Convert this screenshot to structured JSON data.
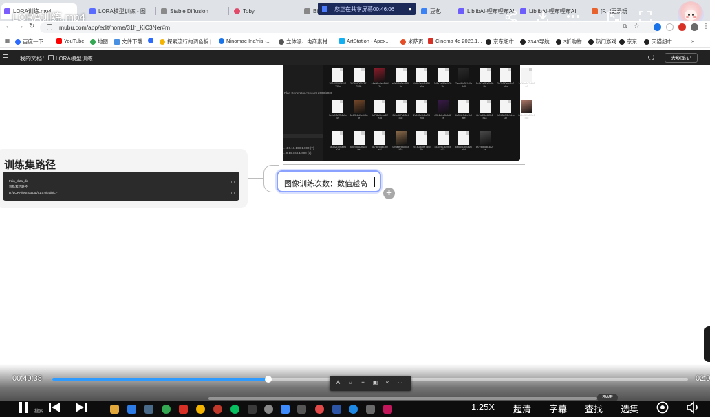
{
  "browser": {
    "tabs": [
      {
        "label": "LORA训练.mp4",
        "color": "#7a5cff"
      },
      {
        "label": "LORA模型训练 - 图",
        "color": "#5a6cff"
      },
      {
        "label": "Stable Diffusion",
        "color": "#8a8a8a"
      },
      {
        "label": "Toby",
        "color": "#e24a6a"
      },
      {
        "label": "Bi",
        "color": "#888888"
      },
      {
        "label": "豆包",
        "color": "#3b82f6"
      },
      {
        "label": "LiblibAI-哩布哩布AI",
        "color": "#6d5dfc"
      },
      {
        "label": "LiblibAI-哩布哩布AI",
        "color": "#6d5dfc"
      },
      {
        "label": "[F...]更爱玩",
        "color": "#e8622d"
      }
    ],
    "share_banner": "您正在共享屏幕00:46:06",
    "url": "mubu.com/app/edit/home/31h_KiC3Ner#m",
    "bookmarks": [
      {
        "label": "百度一下",
        "color": "#2d6bff"
      },
      {
        "label": "YouTube",
        "color": "#ff0000"
      },
      {
        "label": "地图",
        "color": "#34a853"
      },
      {
        "label": "文件下载",
        "color": "#4a90e2"
      },
      {
        "label": "",
        "color": "#2d6bff"
      },
      {
        "label": "探索流行的调色板 |...",
        "color": "#f4b400"
      },
      {
        "label": "Ninomae Ina'nis -...",
        "color": "#1a73e8"
      },
      {
        "label": "立体派、电商素材...",
        "color": "#555555"
      },
      {
        "label": "ArtStation - Apex...",
        "color": "#13aff0"
      },
      {
        "label": "米萨页",
        "color": "#e44d26"
      },
      {
        "label": "Cinema 4d 2023.1...",
        "color": "#d93025"
      },
      {
        "label": "京东超市",
        "color": "#222222"
      },
      {
        "label": "2345导航",
        "color": "#222222"
      },
      {
        "label": "3折购物",
        "color": "#222222"
      },
      {
        "label": "热门游戏",
        "color": "#222222"
      },
      {
        "label": "京东",
        "color": "#222222"
      },
      {
        "label": "天猫超市",
        "color": "#222222"
      }
    ]
  },
  "video": {
    "title": "LORA训练.mp4",
    "current_time": "00:40:38",
    "total_time": "02:0",
    "progress": 0.34,
    "speed": "1.25X",
    "quality": "超清",
    "subtitles": "字幕",
    "search": "查找",
    "episodes": "选集",
    "swp": "SWP"
  },
  "app": {
    "breadcrumb_root": "我的文档",
    "breadcrumb_sep": "/",
    "breadcrumb_doc": "LORA模型训练",
    "notes_button": "大纲笔记"
  },
  "mindmap": {
    "embedded_left_text": "Plan Generator Account 2003/2030",
    "embedded_bottom_lines": [
      "...4.0.16.168.1.000 (T)",
      "...0.16.168.1.000 (L)"
    ],
    "parent_node_title": "训练集路径",
    "code_lines": [
      "train_data_dir",
      "训练素材路径",
      "D:/LORA/test-output/v1.0.0/train/LF"
    ],
    "child_node_text": "图像训练次数：数值越高",
    "add_symbol": "+",
    "thumbnails": [
      {
        "type": "file",
        "caption": "2024040916341234a"
      },
      {
        "type": "file",
        "caption": "2024040916341235b"
      },
      {
        "type": "image",
        "caption": "a4e0f9c6ec8b5f2c",
        "color": "#8a1c2a"
      },
      {
        "type": "file",
        "caption": "e4e0f9c6ec8b5f2c"
      },
      {
        "type": "file",
        "caption": "4a9b7e6c3d2f1e0a"
      },
      {
        "type": "file",
        "caption": "9c8b7a6f5e4d3c2b"
      },
      {
        "type": "image",
        "caption": "7ea5f3c2b1a0e9d8",
        "color": "#2b2b2b"
      },
      {
        "type": "file",
        "caption": "5c4b3a2f1e0d9c8b"
      },
      {
        "type": "file",
        "caption": "3b2a1f0e9d8c7b6a"
      },
      {
        "type": "file",
        "caption": "1a0f9e8d7c6b5a4f"
      },
      {
        "type": "file",
        "caption": "1c0e9f8d7b6a5c4e"
      },
      {
        "type": "image",
        "caption": "6c4f3e2d1c0b9a8f",
        "color": "#7a4a2a"
      },
      {
        "type": "file",
        "caption": "8e7d6c5b4a3f2e1d"
      },
      {
        "type": "file",
        "caption": "0d9c8b7a6f5e4d3c"
      },
      {
        "type": "file",
        "caption": "2e1d0c9b8a7f6e5d"
      },
      {
        "type": "image",
        "caption": "4f3e2d1c0b9a8f7e",
        "color": "#3a1a4a"
      },
      {
        "type": "file",
        "caption": "6a5f4e3d2c1b0a9f"
      },
      {
        "type": "file",
        "caption": "8b7a6f5e4d3c2b1a"
      },
      {
        "type": "file",
        "caption": "0c9b8a7f6e5d4c3b"
      },
      {
        "type": "image",
        "caption": "2d1c0b9a8f7e6d5c",
        "color": "#b07a6a"
      },
      {
        "type": "file",
        "caption": "4e3d2c1b0a9f8e7d"
      },
      {
        "type": "file",
        "caption": "6f5e4d3c2b1a0f9e"
      },
      {
        "type": "file",
        "caption": "8a7f6e5d4c3b2a1f"
      },
      {
        "type": "image",
        "caption": "0b9a8f7e6d5c4b3a",
        "color": "#8a6a4a"
      },
      {
        "type": "file",
        "caption": "2c1b0a9f8e7d6c5b"
      },
      {
        "type": "file",
        "caption": "4d3c2b1a0f9e8d7c"
      },
      {
        "type": "file",
        "caption": "6e5d4c3b2a1f0e9d"
      },
      {
        "type": "image",
        "caption": "8f7e6d5c4b3a2f1e",
        "color": "#4a4a4a"
      }
    ]
  }
}
